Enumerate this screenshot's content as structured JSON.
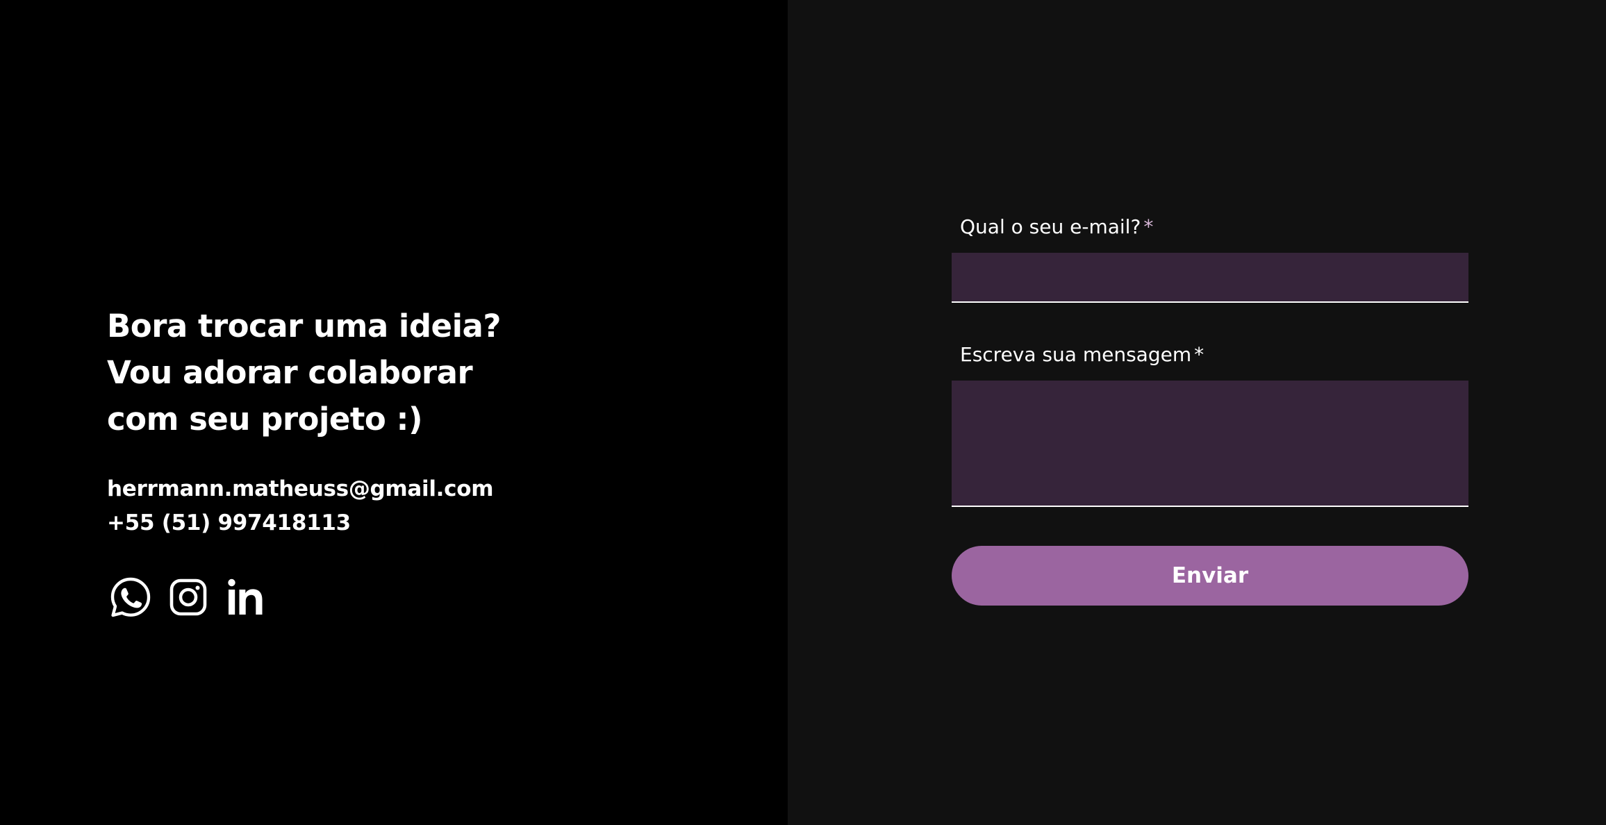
{
  "colors": {
    "left_background": "#000000",
    "right_background": "#111111",
    "input_background": "#36243a",
    "button_background": "#9b65a0",
    "text": "#ffffff"
  },
  "intro": {
    "headline_lines": [
      "Bora trocar uma ideia?",
      "Vou adorar colaborar",
      "com seu projeto :)"
    ]
  },
  "contact": {
    "email": "herrmann.matheuss@gmail.com",
    "phone": "+55 (51) 997418113"
  },
  "socials": [
    {
      "icon": "whatsapp-icon"
    },
    {
      "icon": "instagram-icon"
    },
    {
      "icon": "linkedin-icon"
    }
  ],
  "form": {
    "email_label": "Qual o seu e-mail?",
    "email_required_mark": "*",
    "email_value": "",
    "message_label": "Escreva sua mensagem",
    "message_required_mark": "*",
    "message_value": "",
    "submit_label": "Enviar"
  }
}
